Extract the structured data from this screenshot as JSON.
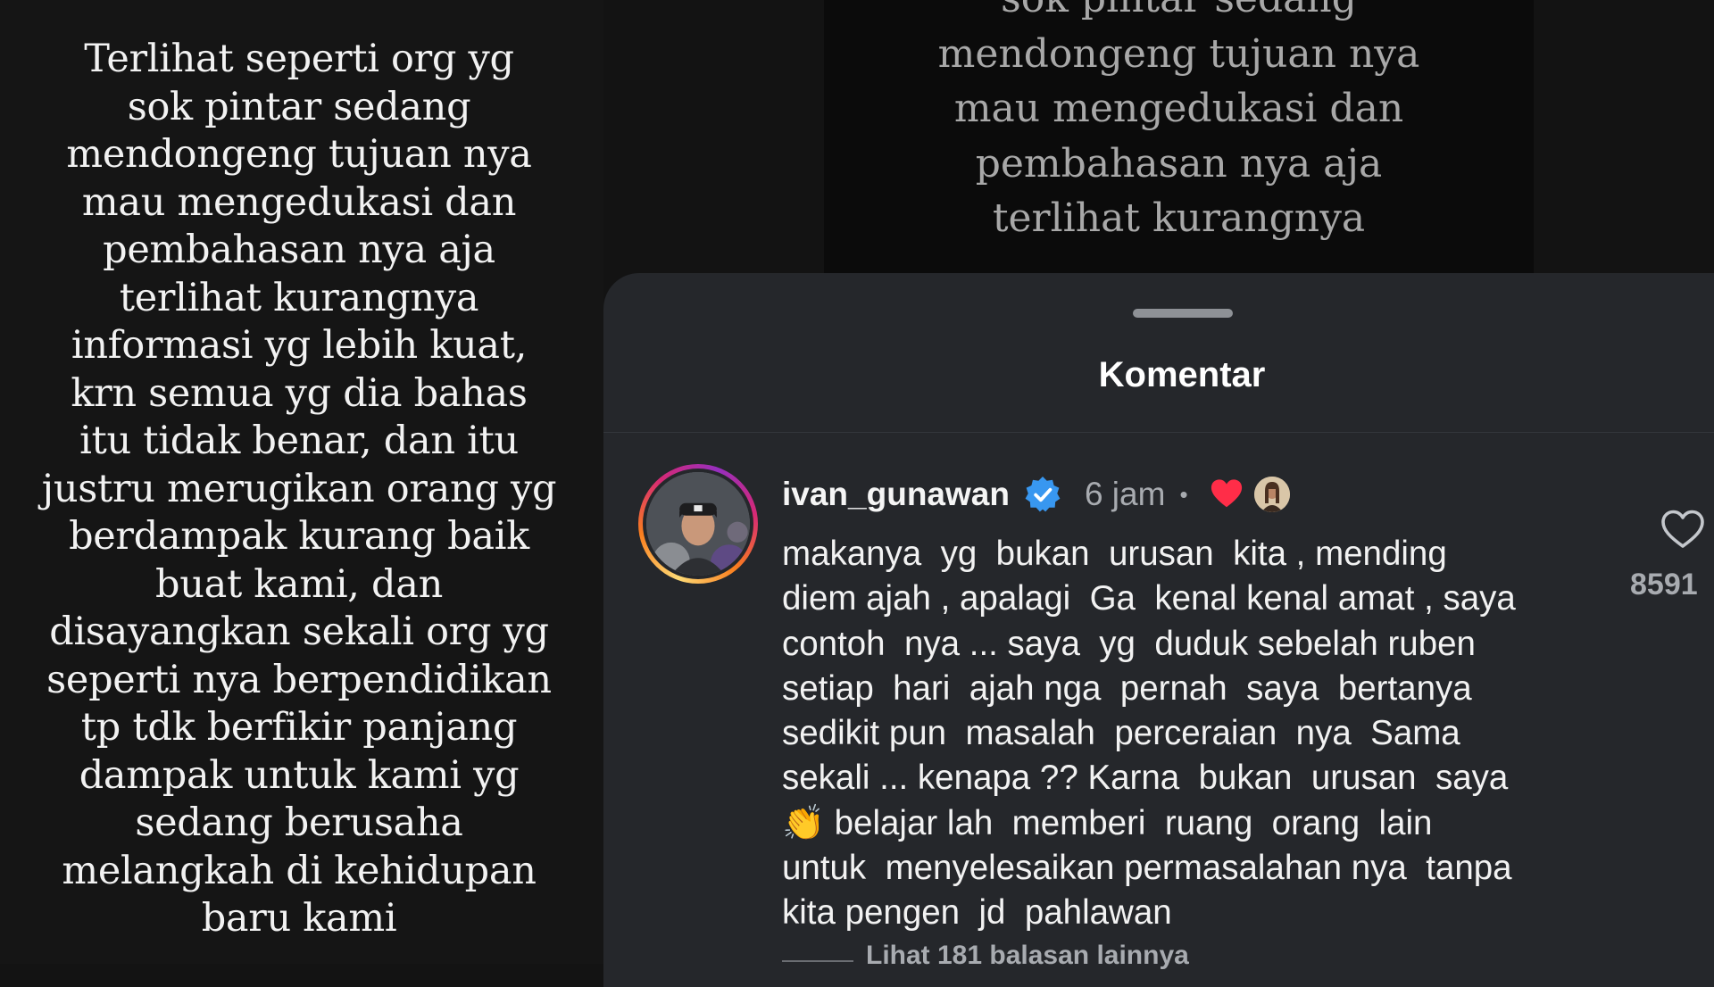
{
  "story": {
    "lines": [
      "Terlihat seperti org  yg",
      "sok pintar  sedang",
      "mendongeng tujuan nya",
      "mau mengedukasi dan",
      "pembahasan nya aja",
      "terlihat kurangnya",
      "informasi yg lebih kuat,",
      "krn semua yg dia bahas",
      "itu tidak benar, dan itu",
      "justru merugikan orang yg",
      "berdampak kurang baik",
      "buat kami, dan",
      "disayangkan sekali org yg",
      "seperti nya berpendidikan",
      "tp tdk berfikir panjang",
      "dampak untuk kami yg",
      "sedang berusaha",
      "melangkah di kehidupan",
      "baru kami"
    ]
  },
  "background_story": {
    "lines": [
      "sok pintar  sedang",
      "mendongeng tujuan nya",
      "mau mengedukasi dan",
      "pembahasan nya aja",
      "terlihat kurangnya"
    ]
  },
  "sheet": {
    "title": "Komentar"
  },
  "comment": {
    "username": "ivan_gunawan",
    "verified": true,
    "time": "6 jam",
    "separator": "•",
    "body_lines": [
      "makanya  yg  bukan  urusan  kita , mending",
      "diem ajah , apalagi  Ga  kenal kenal amat , saya",
      "contoh  nya ... saya  yg  duduk sebelah ruben",
      "setiap  hari  ajah nga  pernah  saya  bertanya",
      "sedikit pun  masalah  perceraian  nya  Sama",
      "sekali ... kenapa ?? Karna  bukan  urusan  saya",
      "👏 belajar lah  memberi  ruang  orang  lain",
      "untuk  menyelesaikan permasalahan nya  tanpa",
      "kita pengen  jd  pahlawan"
    ],
    "view_replies": "Lihat 181 balasan lainnya",
    "like_count": "8591",
    "icons": {
      "verified": "verified-badge-icon",
      "creator_liked": "red-heart-icon",
      "like": "heart-outline-icon"
    },
    "colors": {
      "verified": "#3897f0",
      "heart": "#ff2d48"
    }
  }
}
